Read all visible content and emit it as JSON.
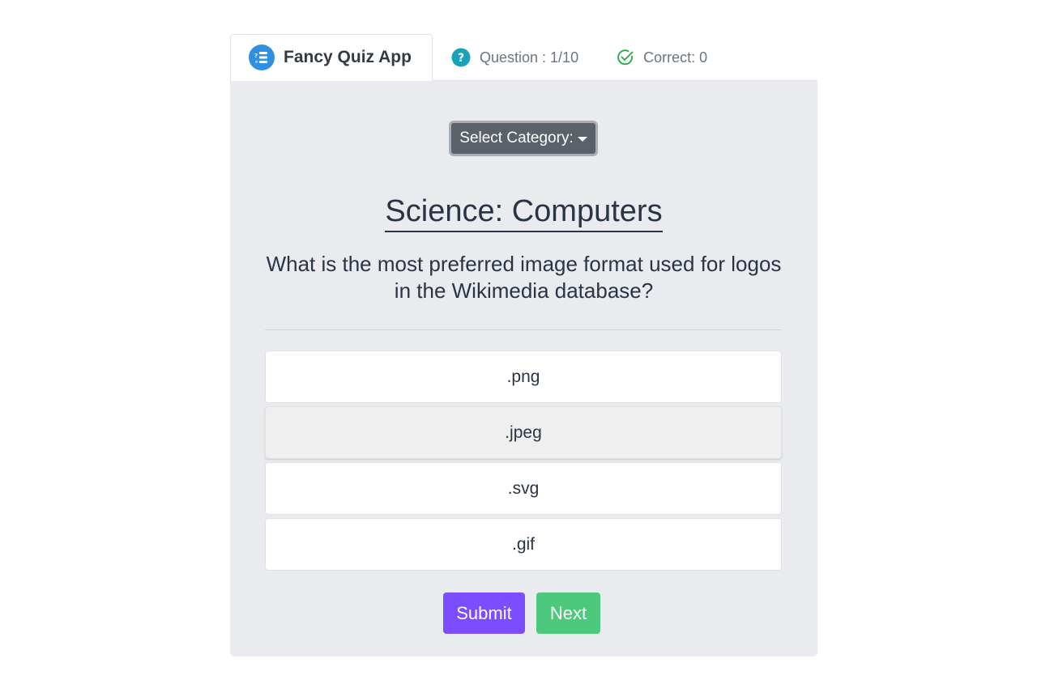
{
  "header": {
    "brand_label": "Fancy Quiz App",
    "question_label": "Question : 1/10",
    "correct_label": "Correct: 0"
  },
  "category_dropdown": {
    "label": "Select Category:"
  },
  "quiz": {
    "category_title": "Science: Computers",
    "question": "What is the most preferred image format used for logos in the Wikimedia database?",
    "answers": [
      ".png",
      ".jpeg",
      ".svg",
      ".gif"
    ]
  },
  "actions": {
    "submit_label": "Submit",
    "next_label": "Next"
  },
  "colors": {
    "card_bg": "#e9ebee",
    "submit": "#7c4dff",
    "next": "#4cc97c",
    "question_icon": "#17a2b8",
    "correct_icon": "#28a745",
    "brand_icon": "#2f8fe0"
  },
  "icons": {
    "brand": "quiz-list-icon",
    "question": "question-circle-icon",
    "correct": "check-circle-icon"
  }
}
